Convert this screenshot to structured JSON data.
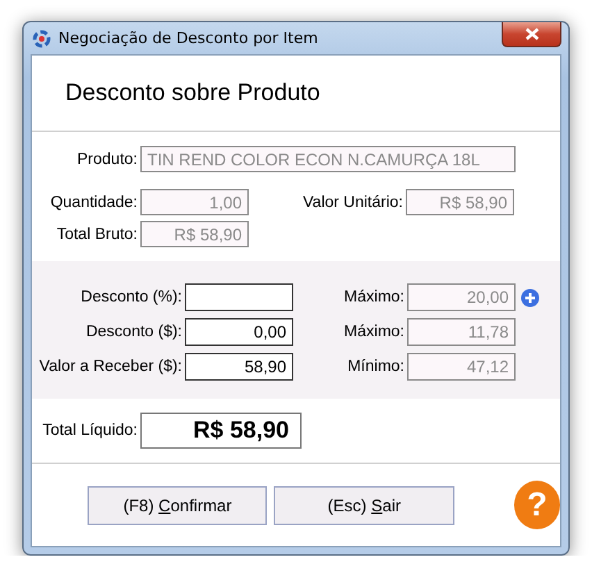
{
  "window": {
    "title": "Negociação de Desconto por Item"
  },
  "header": {
    "title": "Desconto sobre Produto"
  },
  "summary": {
    "rows": [
      [
        {
          "label": "Produto:",
          "value": "TIN REND COLOR ECON N.CAMURÇA 18L",
          "kind": "text",
          "editable": false
        }
      ],
      [
        {
          "label": "Quantidade:",
          "value": "1,00",
          "kind": "number",
          "editable": false
        },
        {
          "label": "Valor Unitário:",
          "value": "R$ 58,90",
          "kind": "number",
          "editable": false
        }
      ],
      [
        {
          "label": "Total Bruto:",
          "value": "R$ 58,90",
          "kind": "number",
          "editable": false
        }
      ]
    ]
  },
  "discount": {
    "rows": [
      [
        {
          "label": "Desconto (%):",
          "kind": "number",
          "editable": true
        },
        {
          "label": "Máximo:",
          "value": "20,00",
          "kind": "number",
          "editable": false,
          "add_button": true
        }
      ],
      [
        {
          "label": "Desconto ($):",
          "value": "0,00",
          "kind": "number",
          "editable": true
        },
        {
          "label": "Máximo:",
          "value": "11,78",
          "kind": "number",
          "editable": false
        }
      ],
      [
        {
          "label": "Valor a Receber ($):",
          "value": "58,90",
          "kind": "number",
          "editable": true
        },
        {
          "label": "Mínimo:",
          "value": "47,12",
          "kind": "number",
          "editable": false
        }
      ]
    ]
  },
  "net_total": {
    "label": "Total Líquido:",
    "value": "R$ 58,90"
  },
  "buttons": [
    {
      "label_parts": [
        "(F8) ",
        "C",
        "onfirmar"
      ]
    },
    {
      "label_parts": [
        "(Esc) ",
        "S",
        "air"
      ]
    }
  ],
  "help": {
    "symbol": "?"
  }
}
